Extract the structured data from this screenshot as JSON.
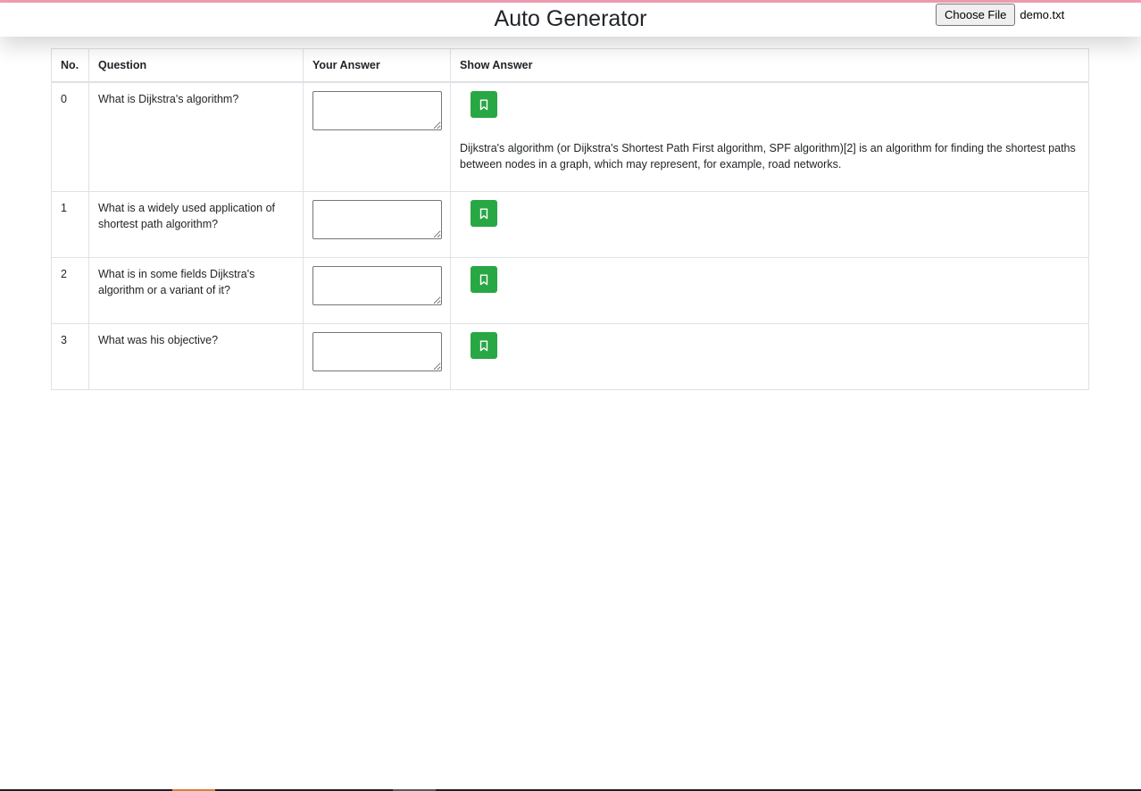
{
  "header": {
    "title": "Auto Generator",
    "file_button_label": "Choose File",
    "file_name": "demo.txt"
  },
  "table": {
    "columns": [
      "No.",
      "Question",
      "Your Answer",
      "Show Answer"
    ],
    "rows": [
      {
        "no": "0",
        "question": "What is Dijkstra's algorithm?",
        "answer_value": "",
        "shown_answer": "Dijkstra's algorithm (or Dijkstra's Shortest Path First algorithm, SPF algorithm)[2] is an algorithm for finding the shortest paths between nodes in a graph, which may represent, for example, road networks."
      },
      {
        "no": "1",
        "question": "What is a widely used application of shortest path algorithm?",
        "answer_value": "",
        "shown_answer": ""
      },
      {
        "no": "2",
        "question": "What is in some fields Dijkstra's algorithm or a variant of it?",
        "answer_value": "",
        "shown_answer": ""
      },
      {
        "no": "3",
        "question": "What was his objective?",
        "answer_value": "",
        "shown_answer": ""
      }
    ],
    "show_button_icon": "bookmark-icon",
    "accent_color": "#28a745"
  }
}
